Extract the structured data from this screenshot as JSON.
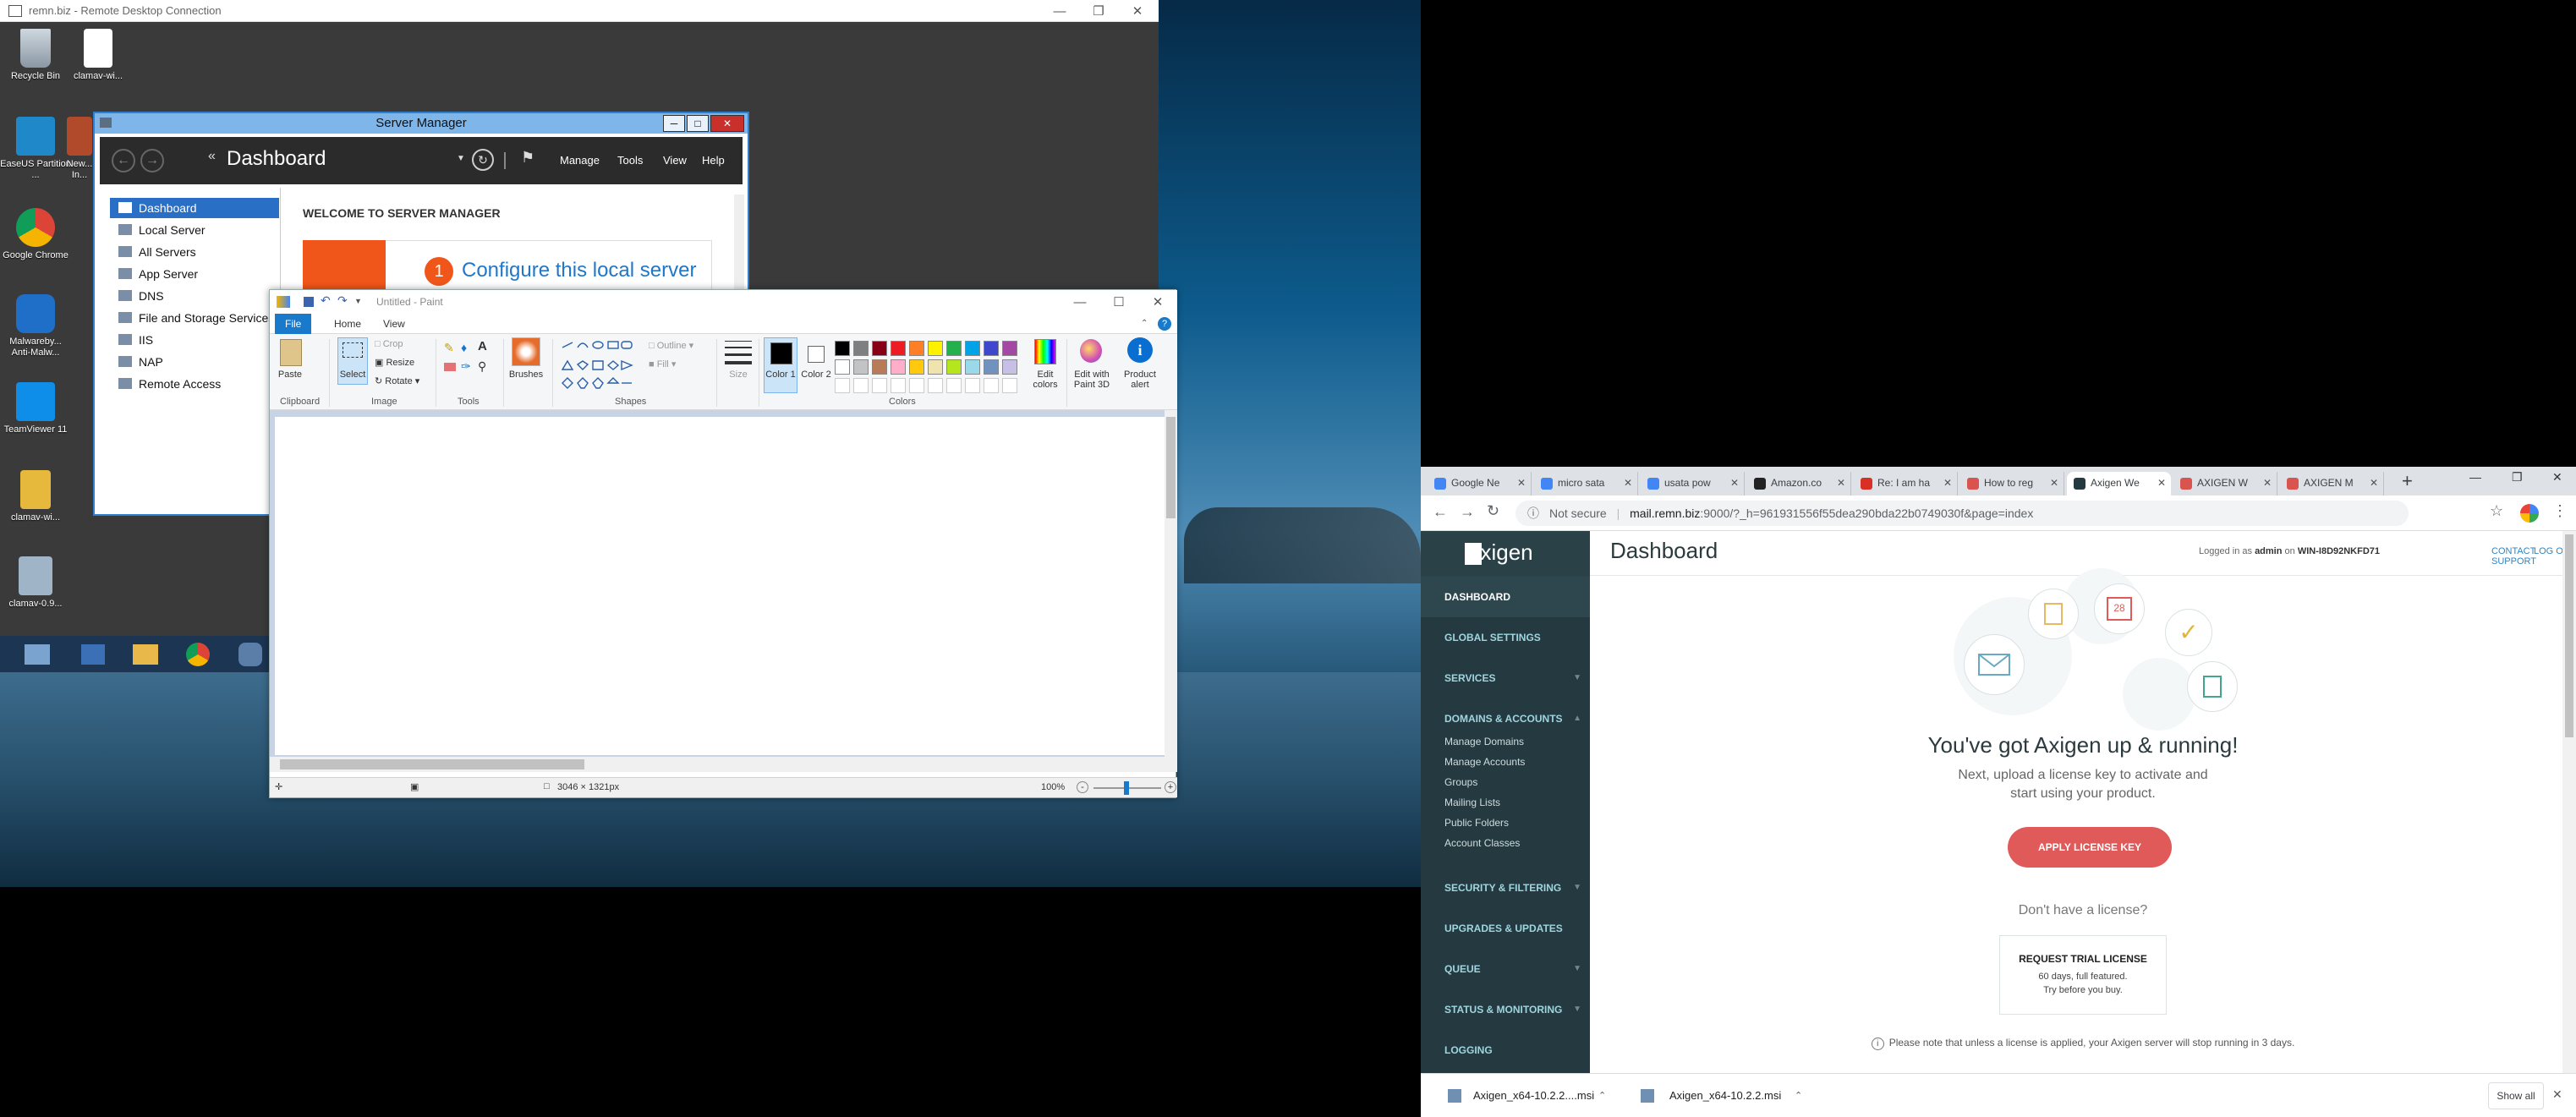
{
  "rdc": {
    "title": "remn.biz - Remote Desktop Connection"
  },
  "desktop_icons": [
    {
      "label": "Recycle Bin"
    },
    {
      "label": "clamav-wi..."
    },
    {
      "label": "EaseUS Partition ..."
    },
    {
      "label": "New... In..."
    },
    {
      "label": "Google Chrome"
    },
    {
      "label": "Malwareby... Anti-Malw..."
    },
    {
      "label": "TeamViewer 11"
    },
    {
      "label": "clamav-wi..."
    },
    {
      "label": "clamav-0.9..."
    }
  ],
  "server_manager": {
    "title": "Server Manager",
    "breadcrumb": "Dashboard",
    "menu": [
      "Manage",
      "Tools",
      "View",
      "Help"
    ],
    "nav": [
      "Dashboard",
      "Local Server",
      "All Servers",
      "App Server",
      "DNS",
      "File and Storage Services",
      "IIS",
      "NAP",
      "Remote Access"
    ],
    "welcome": "WELCOME TO SERVER MANAGER",
    "step_num": "1",
    "step_text": "Configure this local server"
  },
  "paint": {
    "title": "Untitled - Paint",
    "tabs": [
      "File",
      "Home",
      "View"
    ],
    "groups": {
      "clipboard": "Clipboard",
      "image": "Image",
      "tools": "Tools",
      "shapes": "Shapes",
      "colors": "Colors"
    },
    "labels": {
      "paste": "Paste",
      "select": "Select",
      "crop": "Crop",
      "resize": "Resize",
      "rotate": "Rotate",
      "brushes": "Brushes",
      "outline": "Outline",
      "fill": "Fill",
      "size": "Size",
      "color1": "Color 1",
      "color2": "Color 2",
      "edit_colors": "Edit colors",
      "edit_paint3d": "Edit with Paint 3D",
      "product_alert": "Product alert"
    },
    "status": {
      "dims": "3046 × 1321px",
      "zoom": "100%"
    },
    "palette_row1": [
      "#000000",
      "#7f7f7f",
      "#880015",
      "#ed1c24",
      "#ff7f27",
      "#fff200",
      "#22b14c",
      "#00a2e8",
      "#3f48cc",
      "#a349a4"
    ],
    "palette_row2": [
      "#ffffff",
      "#c3c3c3",
      "#b97a57",
      "#ffaec9",
      "#ffc90e",
      "#efe4b0",
      "#b5e61d",
      "#99d9ea",
      "#7092be",
      "#c8bfe7"
    ]
  },
  "chrome": {
    "tabs": [
      {
        "label": "Google Ne",
        "color": "#4285f4"
      },
      {
        "label": "micro sata",
        "color": "#4285f4"
      },
      {
        "label": "usata pow",
        "color": "#4285f4"
      },
      {
        "label": "Amazon.co",
        "color": "#222222"
      },
      {
        "label": "Re: I am ha",
        "color": "#d93025"
      },
      {
        "label": "How to reg",
        "color": "#d9534f"
      },
      {
        "label": "Axigen We",
        "color": "#243a40"
      },
      {
        "label": "AXIGEN W",
        "color": "#d9534f"
      },
      {
        "label": "AXIGEN M",
        "color": "#d9534f"
      }
    ],
    "not_secure": "Not secure",
    "url_host": "mail.remn.biz",
    "url_rest": ":9000/?_h=961931556f55dea290bda22b0749030f&page=index",
    "downloads": [
      "Axigen_x64-10.2.2....msi",
      "Axigen_x64-10.2.2.msi"
    ],
    "show_all": "Show all"
  },
  "axigen": {
    "logo": "axigen",
    "page_title": "Dashboard",
    "logged_in_prefix": "Logged in as",
    "user": "admin",
    "on": "on",
    "host": "WIN-I8D92NKFD71",
    "contact": "CONTACT SUPPORT",
    "logout": "LOG OUT",
    "nav": [
      {
        "label": "DASHBOARD",
        "chev": ""
      },
      {
        "label": "GLOBAL SETTINGS",
        "chev": ""
      },
      {
        "label": "SERVICES",
        "chev": "▼"
      },
      {
        "label": "DOMAINS & ACCOUNTS",
        "chev": "▲"
      }
    ],
    "subnav": [
      "Manage Domains",
      "Manage Accounts",
      "Groups",
      "Mailing Lists",
      "Public Folders",
      "Account Classes"
    ],
    "nav2": [
      {
        "label": "SECURITY & FILTERING",
        "chev": "▼"
      },
      {
        "label": "UPGRADES & UPDATES",
        "chev": ""
      },
      {
        "label": "QUEUE",
        "chev": "▼"
      },
      {
        "label": "STATUS & MONITORING",
        "chev": "▼"
      },
      {
        "label": "LOGGING",
        "chev": ""
      }
    ],
    "calendar_day": "28",
    "headline": "You've got Axigen up & running!",
    "sub1": "Next, upload a license key to activate and",
    "sub2": "start using your product.",
    "apply_btn": "APPLY LICENSE KEY",
    "no_license": "Don't have a license?",
    "trial_title": "REQUEST TRIAL LICENSE",
    "trial_l1": "60 days, full featured.",
    "trial_l2": "Try before you buy.",
    "note": "Please note that unless a license is applied, your Axigen server will stop running in 3 days.",
    "accent": "#e05a5a"
  }
}
